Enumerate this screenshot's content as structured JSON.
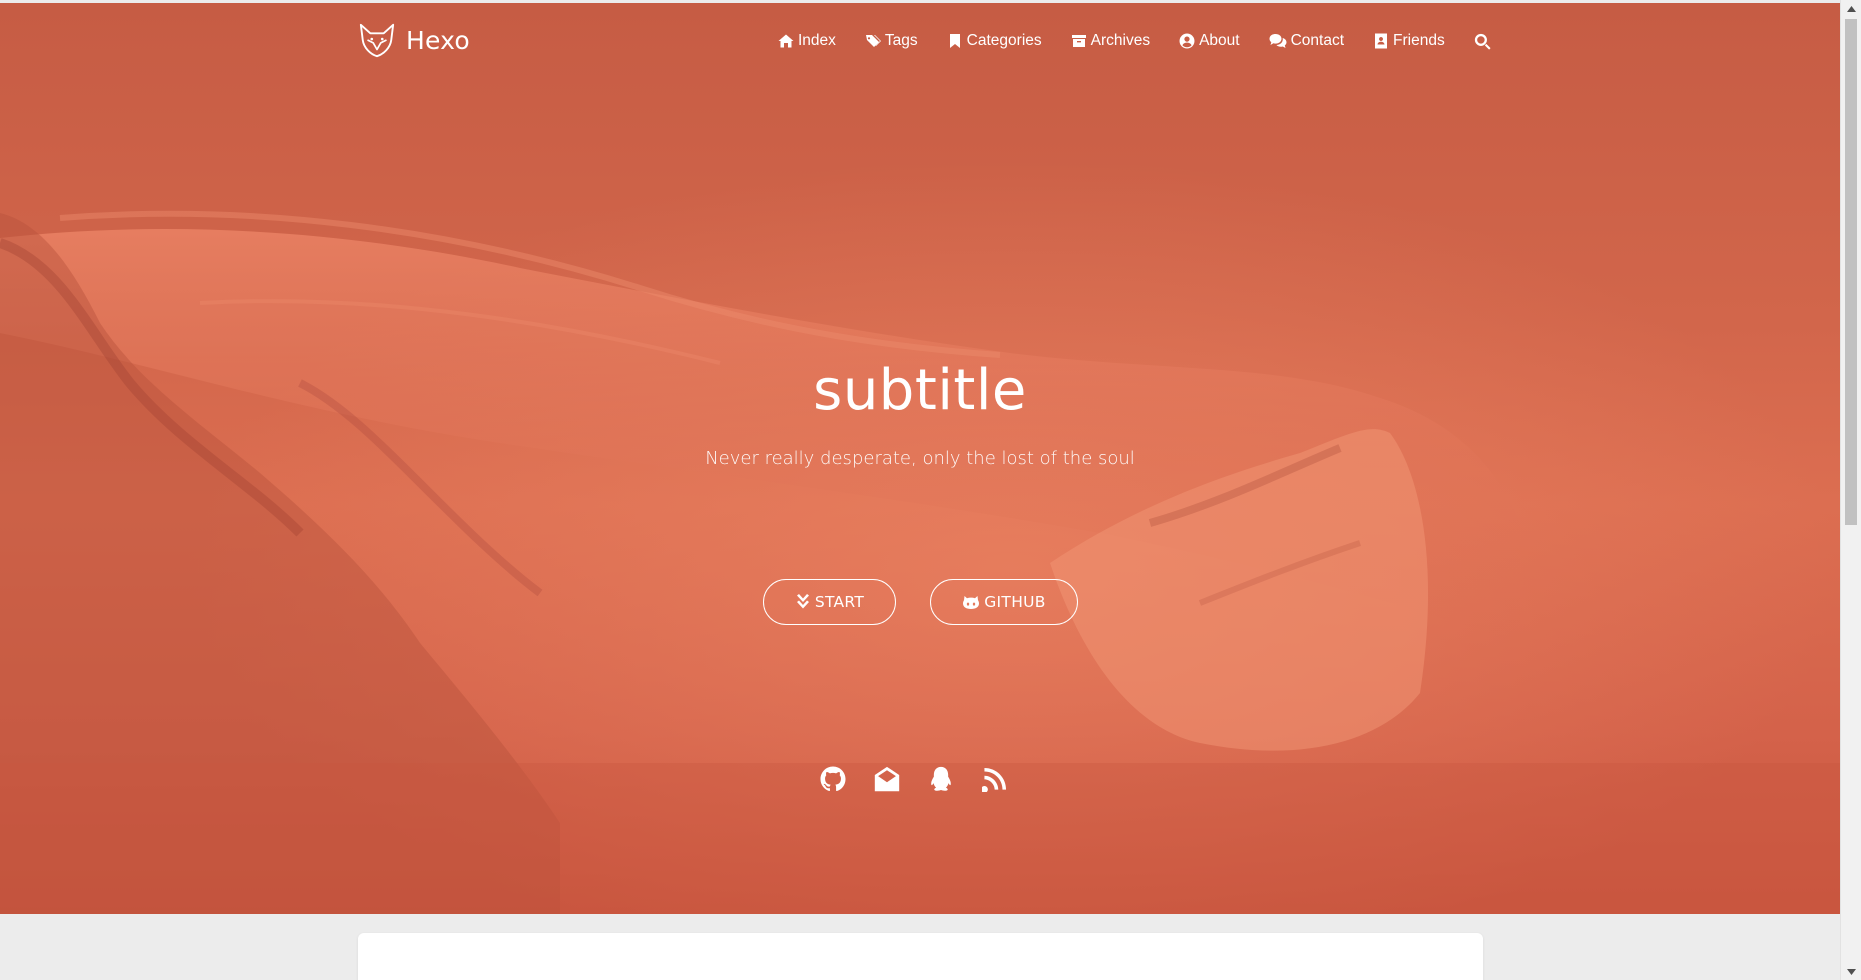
{
  "brand": {
    "name": "Hexo"
  },
  "nav": {
    "items": [
      {
        "label": "Index",
        "icon": "home-icon"
      },
      {
        "label": "Tags",
        "icon": "tags-icon"
      },
      {
        "label": "Categories",
        "icon": "bookmark-icon"
      },
      {
        "label": "Archives",
        "icon": "archive-icon"
      },
      {
        "label": "About",
        "icon": "user-circle-icon"
      },
      {
        "label": "Contact",
        "icon": "comments-icon"
      },
      {
        "label": "Friends",
        "icon": "address-card-icon"
      }
    ],
    "search_icon": "search-icon"
  },
  "hero": {
    "title": "subtitle",
    "tagline": "Never really desperate, only the lost of the soul",
    "start_label": "START",
    "github_label": "GITHUB",
    "social_icons": [
      "github-icon",
      "envelope-open-icon",
      "qq-icon",
      "rss-icon"
    ]
  },
  "colors": {
    "hero_overlay": "#d2664b",
    "text": "#ffffff",
    "page_background": "#ececec",
    "card_background": "#ffffff"
  }
}
